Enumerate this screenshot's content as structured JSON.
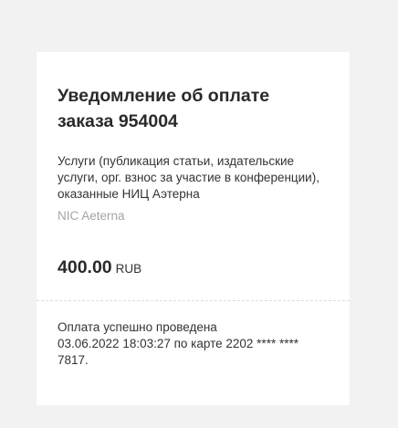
{
  "invoice": {
    "title": "Уведомление об оплате заказа 954004",
    "description": "Услуги (публикация статьи, издательские услуги, орг. взнос за участие в конференции), оказанные НИЦ Аэтерна",
    "merchant": "NIC Aeterna",
    "amount": "400.00",
    "currency": "RUB"
  },
  "status": {
    "message": "Оплата успешно проведена",
    "details": "03.06.2022 18:03:27 по карте 2202 **** **** 7817."
  },
  "colors": {
    "background": "#f2f2f2",
    "card": "#ffffff",
    "muted_text": "#a5a5a5"
  }
}
